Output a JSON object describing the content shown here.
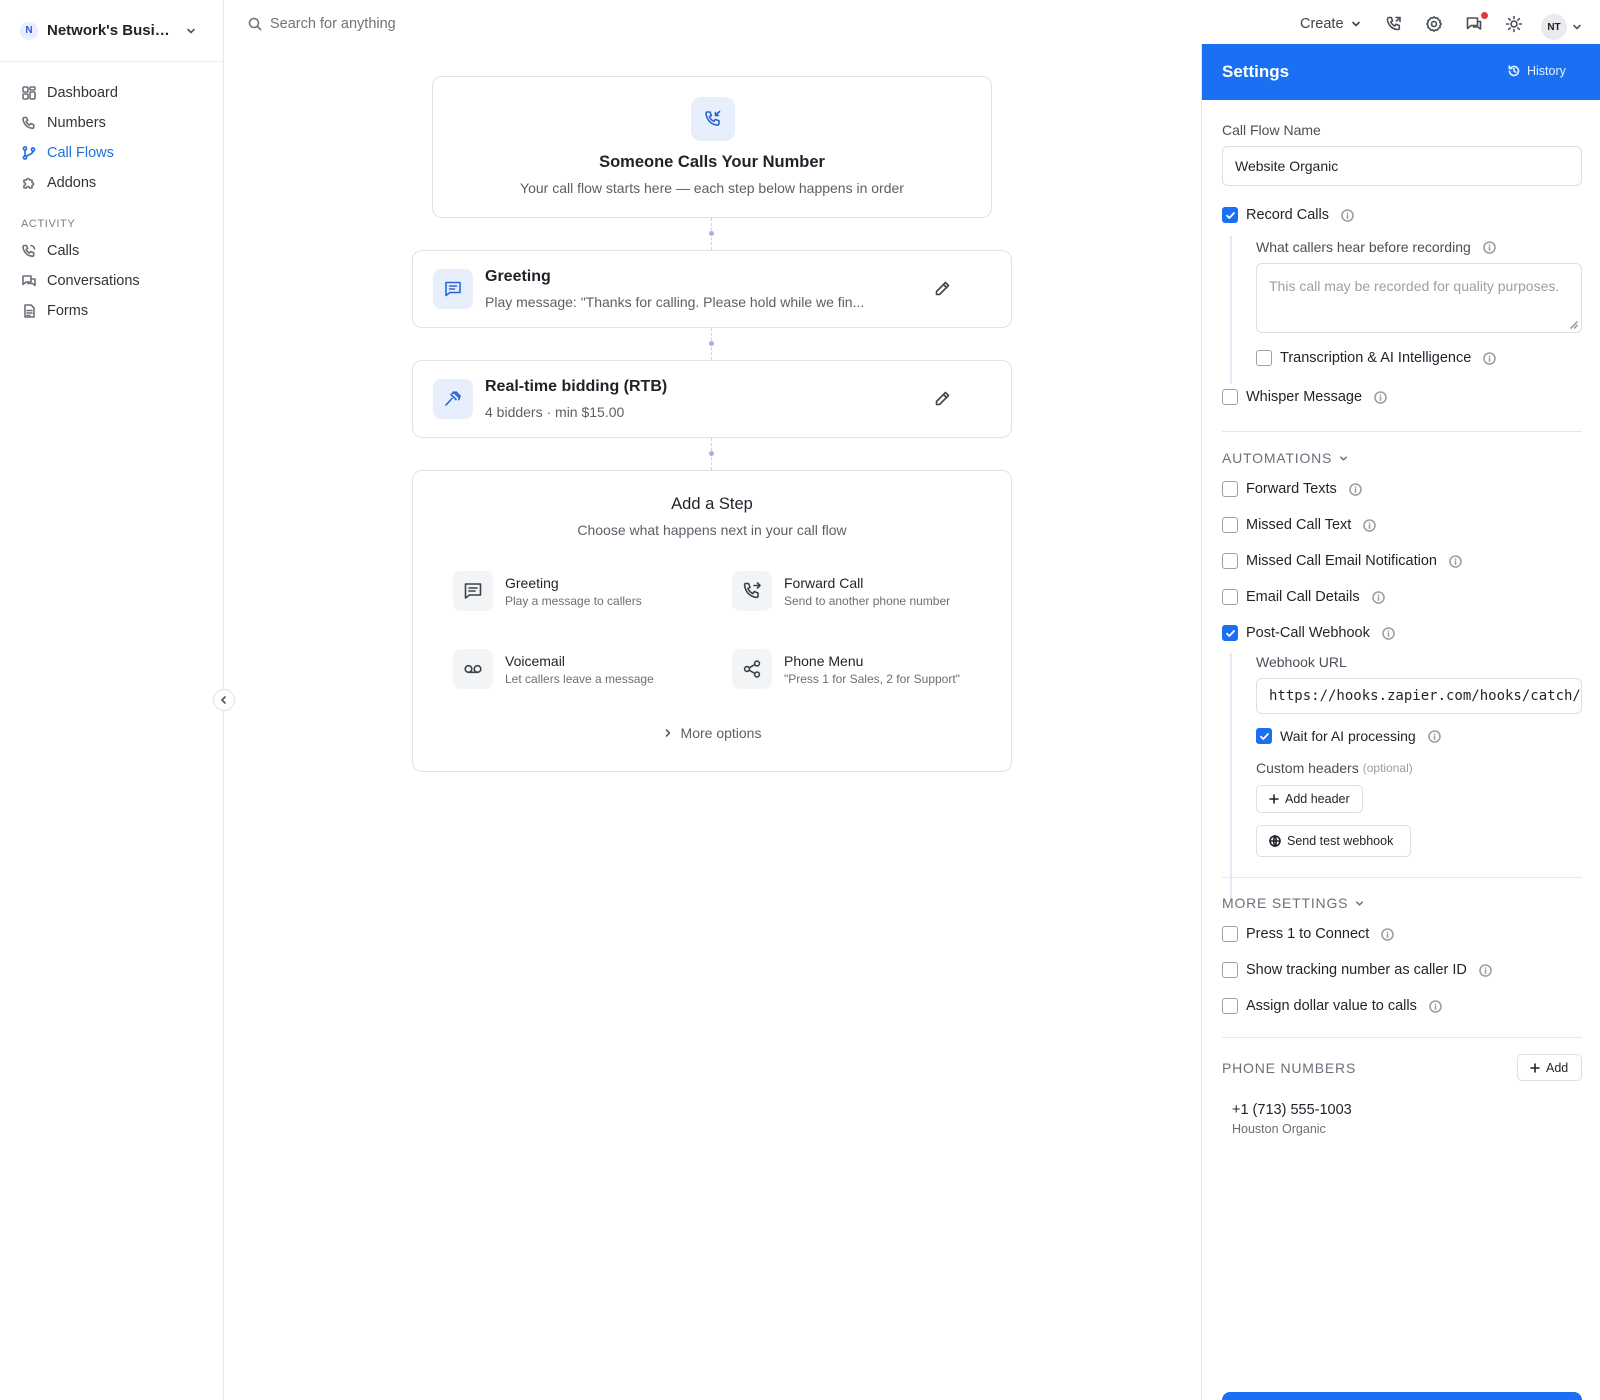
{
  "workspace": {
    "badge": "N",
    "name": "Network's Business"
  },
  "nav": {
    "items": [
      {
        "label": "Dashboard",
        "icon": "dashboard-icon"
      },
      {
        "label": "Numbers",
        "icon": "phone-icon"
      },
      {
        "label": "Call Flows",
        "icon": "flow-icon",
        "active": true
      },
      {
        "label": "Addons",
        "icon": "puzzle-icon"
      }
    ],
    "activity_header": "ACTIVITY",
    "activity": [
      {
        "label": "Calls",
        "icon": "phone-calls-icon"
      },
      {
        "label": "Conversations",
        "icon": "chat-icon"
      },
      {
        "label": "Forms",
        "icon": "form-icon"
      }
    ]
  },
  "topbar": {
    "search_placeholder": "Search for anything",
    "create_label": "Create",
    "avatar_initials": "NT"
  },
  "flow": {
    "start": {
      "title": "Someone Calls Your Number",
      "subtitle": "Your call flow starts here — each step below happens in order"
    },
    "steps": [
      {
        "title": "Greeting",
        "subtitle": "Play message: \"Thanks for calling. Please hold while we fin..."
      },
      {
        "title": "Real-time bidding (RTB)",
        "subtitle": "4 bidders · min $15.00"
      }
    ],
    "add_step": {
      "title": "Add a Step",
      "subtitle": "Choose what happens next in your call flow",
      "options": [
        {
          "title": "Greeting",
          "subtitle": "Play a message to callers",
          "icon": "message-icon"
        },
        {
          "title": "Forward Call",
          "subtitle": "Send to another phone number",
          "icon": "forward-call-icon"
        },
        {
          "title": "Voicemail",
          "subtitle": "Let callers leave a message",
          "icon": "voicemail-icon"
        },
        {
          "title": "Phone Menu",
          "subtitle": "\"Press 1 for Sales, 2 for Support\"",
          "icon": "share-icon"
        }
      ],
      "more_label": "More options"
    }
  },
  "settings": {
    "title": "Settings",
    "history_label": "History",
    "call_flow_name_label": "Call Flow Name",
    "call_flow_name_value": "Website Organic",
    "record_calls": {
      "label": "Record Calls",
      "checked": true
    },
    "recording_msg_label": "What callers hear before recording",
    "recording_msg_placeholder": "This call may be recorded for quality purposes.",
    "transcription": {
      "label": "Transcription & AI Intelligence",
      "checked": false
    },
    "whisper": {
      "label": "Whisper Message",
      "checked": false
    },
    "automations_header": "AUTOMATIONS",
    "automations": [
      {
        "label": "Forward Texts",
        "checked": false
      },
      {
        "label": "Missed Call Text",
        "checked": false
      },
      {
        "label": "Missed Call Email Notification",
        "checked": false
      },
      {
        "label": "Email Call Details",
        "checked": false
      },
      {
        "label": "Post-Call Webhook",
        "checked": true
      }
    ],
    "webhook_url_label": "Webhook URL",
    "webhook_url_value": "https://hooks.zapier.com/hooks/catch/",
    "wait_ai": {
      "label": "Wait for AI processing",
      "checked": true
    },
    "custom_headers_label": "Custom headers",
    "custom_headers_optional": "(optional)",
    "add_header_label": "Add header",
    "send_test_label": "Send test webhook",
    "more_settings_header": "MORE SETTINGS",
    "more_settings": [
      {
        "label": "Press 1 to Connect",
        "checked": false
      },
      {
        "label": "Show tracking number as caller ID",
        "checked": false
      },
      {
        "label": "Assign dollar value to calls",
        "checked": false
      }
    ],
    "phone_numbers_header": "PHONE NUMBERS",
    "add_label": "Add",
    "phone_number": "+1 (713) 555-1003",
    "phone_location": "Houston Organic"
  },
  "colors": {
    "accent": "#1b6ff2",
    "link": "#1f6fe0",
    "icon_bg": "#e7effd"
  }
}
